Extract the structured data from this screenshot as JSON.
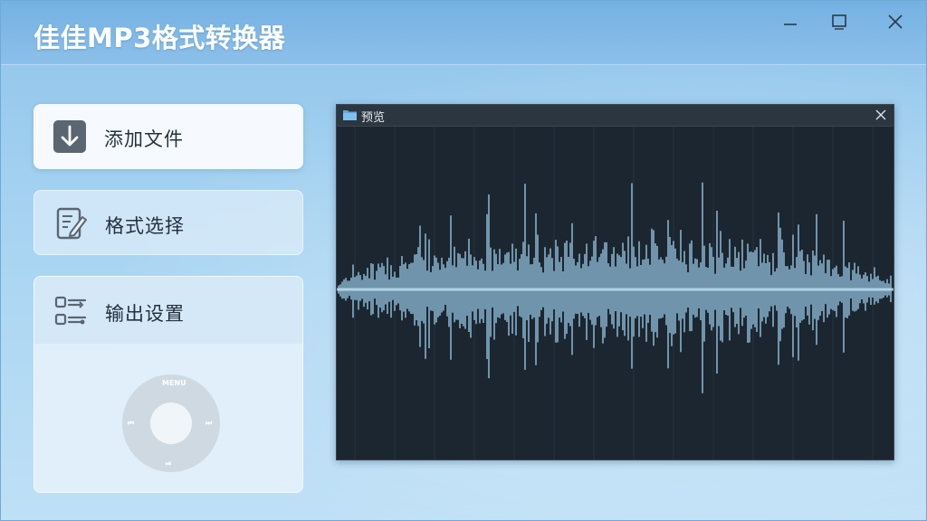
{
  "window": {
    "title": "佳佳MP3格式转换器",
    "controls": {
      "minimize": "minimize",
      "maximize": "maximize",
      "close": "close"
    }
  },
  "sidebar": {
    "items": [
      {
        "label": "添加文件",
        "icon": "download-arrow-icon"
      },
      {
        "label": "格式选择",
        "icon": "edit-document-icon"
      },
      {
        "label": "输出设置",
        "icon": "settings-sliders-icon"
      }
    ],
    "player_wheel": {
      "top": "MENU",
      "left": "⏮",
      "right": "⏭",
      "bottom": "⏯"
    }
  },
  "preview": {
    "title": "预览",
    "icons": {
      "folder": "folder-icon",
      "close": "close-icon"
    },
    "waveform_color": "#9fd0ee",
    "background_color": "#1c2630"
  },
  "colors": {
    "titlebar": "#74b1e3",
    "accent": "#8fc4eb",
    "card": "#f6fafe"
  }
}
